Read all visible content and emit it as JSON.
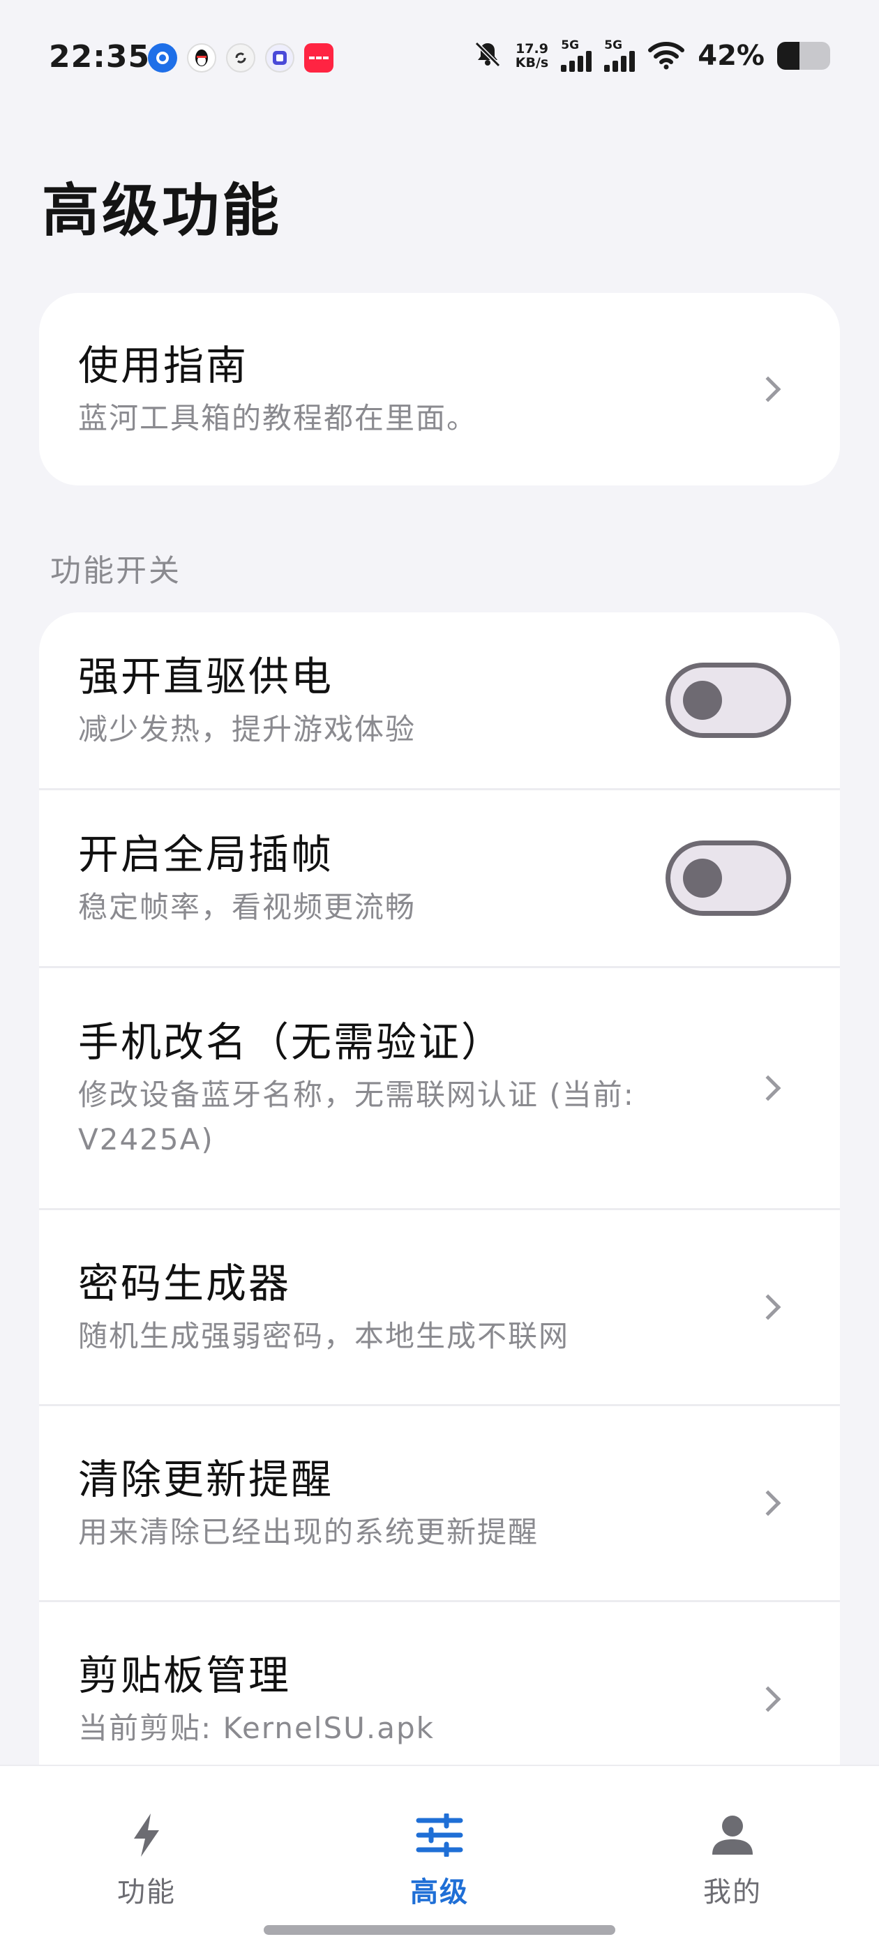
{
  "status_bar": {
    "time": "22:35",
    "notif_icons": [
      {
        "name": "app-circle-icon",
        "glyph": "●",
        "color": "#1e6fe8"
      },
      {
        "name": "qq-penguin-icon",
        "glyph": "🐧",
        "color": "#111111"
      },
      {
        "name": "sync-app-icon",
        "glyph": "↻",
        "color": "#333333"
      },
      {
        "name": "tieba-icon",
        "glyph": "贴",
        "color": "#4a4ad8"
      },
      {
        "name": "xiaohongshu-icon",
        "glyph": "小红书",
        "color": "#ff2442"
      }
    ],
    "net_speed_value": "17.9",
    "net_speed_unit": "KB/s",
    "signal_1_label": "5G",
    "signal_2_label": "5G",
    "battery_text": "42%",
    "battery_level": 0.42
  },
  "page": {
    "title": "高级功能"
  },
  "guide": {
    "title": "使用指南",
    "subtitle": "蓝河工具箱的教程都在里面。"
  },
  "section_label": "功能开关",
  "features": [
    {
      "title": "强开直驱供电",
      "subtitle": "减少发热，提升游戏体验",
      "type": "toggle",
      "on": false
    },
    {
      "title": "开启全局插帧",
      "subtitle": "稳定帧率，看视频更流畅",
      "type": "toggle",
      "on": false
    },
    {
      "title": "手机改名（无需验证）",
      "subtitle": "修改设备蓝牙名称，无需联网认证 (当前: V2425A)",
      "type": "link"
    },
    {
      "title": "密码生成器",
      "subtitle": "随机生成强弱密码，本地生成不联网",
      "type": "link"
    },
    {
      "title": "清除更新提醒",
      "subtitle": "用来清除已经出现的系统更新提醒",
      "type": "link"
    },
    {
      "title": "剪贴板管理",
      "subtitle": "当前剪贴: KernelSU.apk",
      "type": "link"
    }
  ],
  "bottom_nav": {
    "items": [
      {
        "label": "功能",
        "icon": "lightning-icon",
        "active": false
      },
      {
        "label": "高级",
        "icon": "sliders-icon",
        "active": true
      },
      {
        "label": "我的",
        "icon": "person-icon",
        "active": false
      }
    ]
  },
  "colors": {
    "accent": "#1f6fd6",
    "background": "#f4f4f8",
    "card": "#ffffff",
    "subtitle_text": "#8a8a8f"
  }
}
